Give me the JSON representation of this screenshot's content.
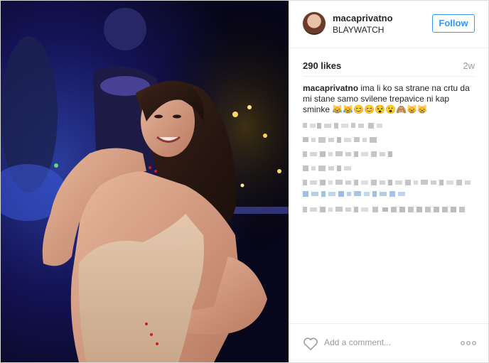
{
  "post": {
    "username": "macaprivatno",
    "location": "BLAYWATCH",
    "follow_label": "Follow",
    "likes": "290 likes",
    "time_ago": "2w",
    "caption_user": "macaprivatno",
    "caption_text": "ima li ko sa strane na crtu da mi stane samo svilene trepavice ni kap sminke",
    "caption_emoji": "😹😹😊😊😵😮🙈😸😸",
    "comment_placeholder": "Add a comment..."
  },
  "icons": {
    "avatar": "profile-photo",
    "like": "heart-outline-icon",
    "more": "more-options-dots-icon"
  },
  "colors": {
    "follow_blue": "#3897f0",
    "text_dark": "#262626",
    "text_gray": "#999999",
    "divider": "#efefef"
  }
}
